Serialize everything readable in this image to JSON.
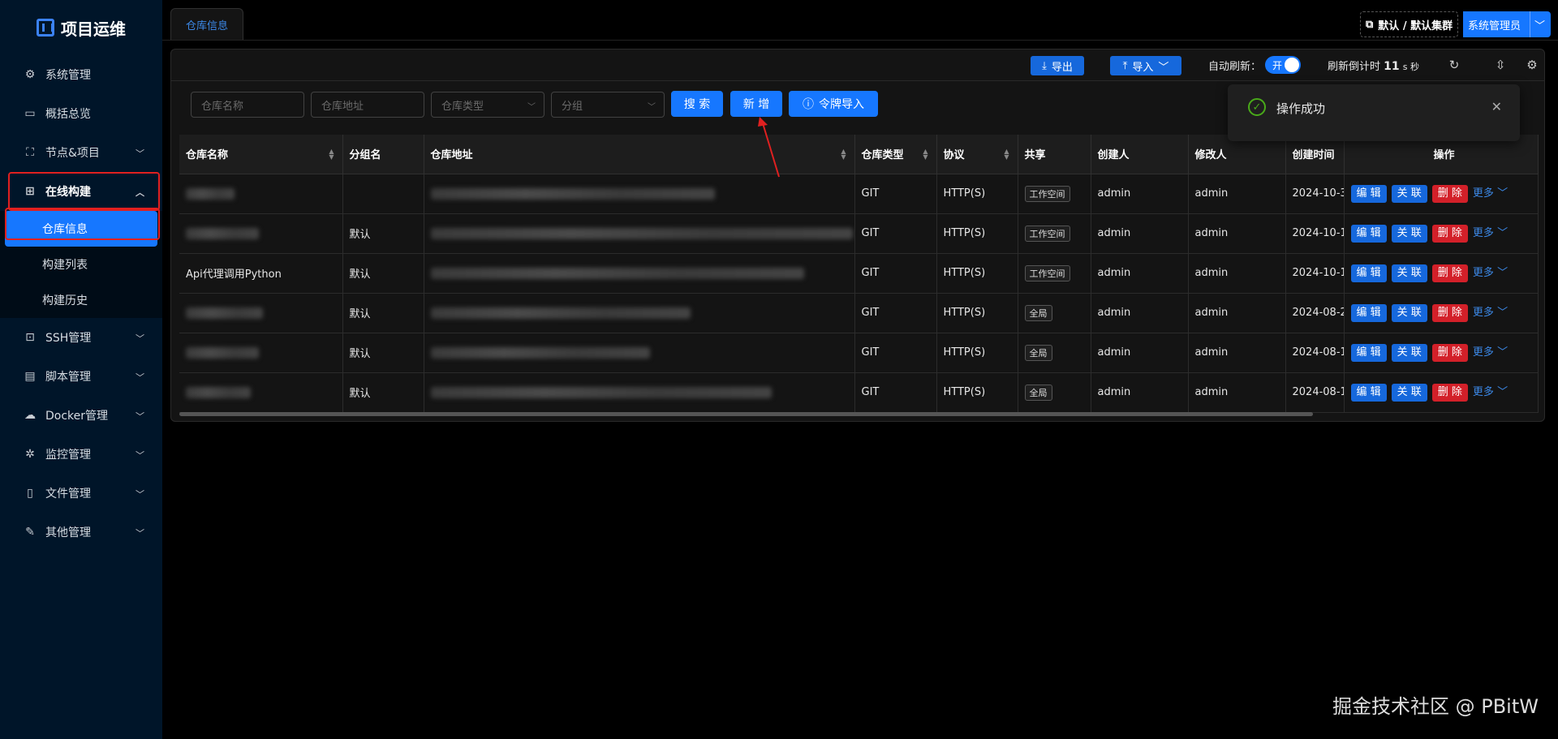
{
  "brand": {
    "title": "项目运维"
  },
  "sidebar": {
    "items": [
      {
        "label": "系统管理",
        "icon": "gear-icon",
        "chevron": false
      },
      {
        "label": "概括总览",
        "icon": "monitor-icon",
        "chevron": false
      },
      {
        "label": "节点&项目",
        "icon": "cluster-icon",
        "chevron": true
      },
      {
        "label": "在线构建",
        "icon": "build-icon",
        "chevron": true,
        "open": true
      },
      {
        "label": "SSH管理",
        "icon": "terminal-icon",
        "chevron": true
      },
      {
        "label": "脚本管理",
        "icon": "file-code-icon",
        "chevron": true
      },
      {
        "label": "Docker管理",
        "icon": "cloud-icon",
        "chevron": true
      },
      {
        "label": "监控管理",
        "icon": "bug-icon",
        "chevron": true
      },
      {
        "label": "文件管理",
        "icon": "file-icon",
        "chevron": true
      },
      {
        "label": "其他管理",
        "icon": "tool-icon",
        "chevron": true
      }
    ],
    "submenu": [
      "仓库信息",
      "构建列表",
      "构建历史"
    ]
  },
  "tab": {
    "label": "仓库信息"
  },
  "header": {
    "cluster": "默认 / 默认集群",
    "user": "系统管理员"
  },
  "toolbar": {
    "export": "导出",
    "import": "导入",
    "auto_refresh_label": "自动刷新：",
    "switch_text": "开",
    "countdown_prefix": "刷新倒计时",
    "countdown_value": "11",
    "countdown_unit": "s 秒"
  },
  "filters": {
    "name": "仓库名称",
    "address": "仓库地址",
    "type": "仓库类型",
    "group": "分组",
    "search": "搜 索",
    "add": "新 增",
    "token_import": "令牌导入"
  },
  "table": {
    "columns": [
      "仓库名称",
      "分组名",
      "仓库地址",
      "仓库类型",
      "协议",
      "共享",
      "创建人",
      "修改人",
      "创建时间",
      "操作"
    ],
    "rows": [
      {
        "name": "",
        "group": "",
        "type": "GIT",
        "protocol": "HTTP(S)",
        "share": "工作空间",
        "creator": "admin",
        "modifier": "admin",
        "created": "2024-10-3"
      },
      {
        "name": "",
        "group": "默认",
        "type": "GIT",
        "protocol": "HTTP(S)",
        "share": "工作空间",
        "creator": "admin",
        "modifier": "admin",
        "created": "2024-10-1"
      },
      {
        "name": "Api代理调用Python",
        "group": "默认",
        "type": "GIT",
        "protocol": "HTTP(S)",
        "share": "工作空间",
        "creator": "admin",
        "modifier": "admin",
        "created": "2024-10-1"
      },
      {
        "name": "",
        "group": "默认",
        "type": "GIT",
        "protocol": "HTTP(S)",
        "share": "全局",
        "creator": "admin",
        "modifier": "admin",
        "created": "2024-08-2"
      },
      {
        "name": "",
        "group": "默认",
        "type": "GIT",
        "protocol": "HTTP(S)",
        "share": "全局",
        "creator": "admin",
        "modifier": "admin",
        "created": "2024-08-1"
      },
      {
        "name": "",
        "group": "默认",
        "type": "GIT",
        "protocol": "HTTP(S)",
        "share": "全局",
        "creator": "admin",
        "modifier": "admin",
        "created": "2024-08-1"
      }
    ],
    "ops": {
      "edit": "编 辑",
      "link": "关 联",
      "delete": "删 除",
      "more": "更多"
    }
  },
  "toast": {
    "message": "操作成功"
  },
  "watermark": "掘金技术社区 @ PBitW",
  "colors": {
    "primary": "#1677ff",
    "danger": "#d32029",
    "success": "#49aa19",
    "sidebar_bg": "#001529"
  }
}
